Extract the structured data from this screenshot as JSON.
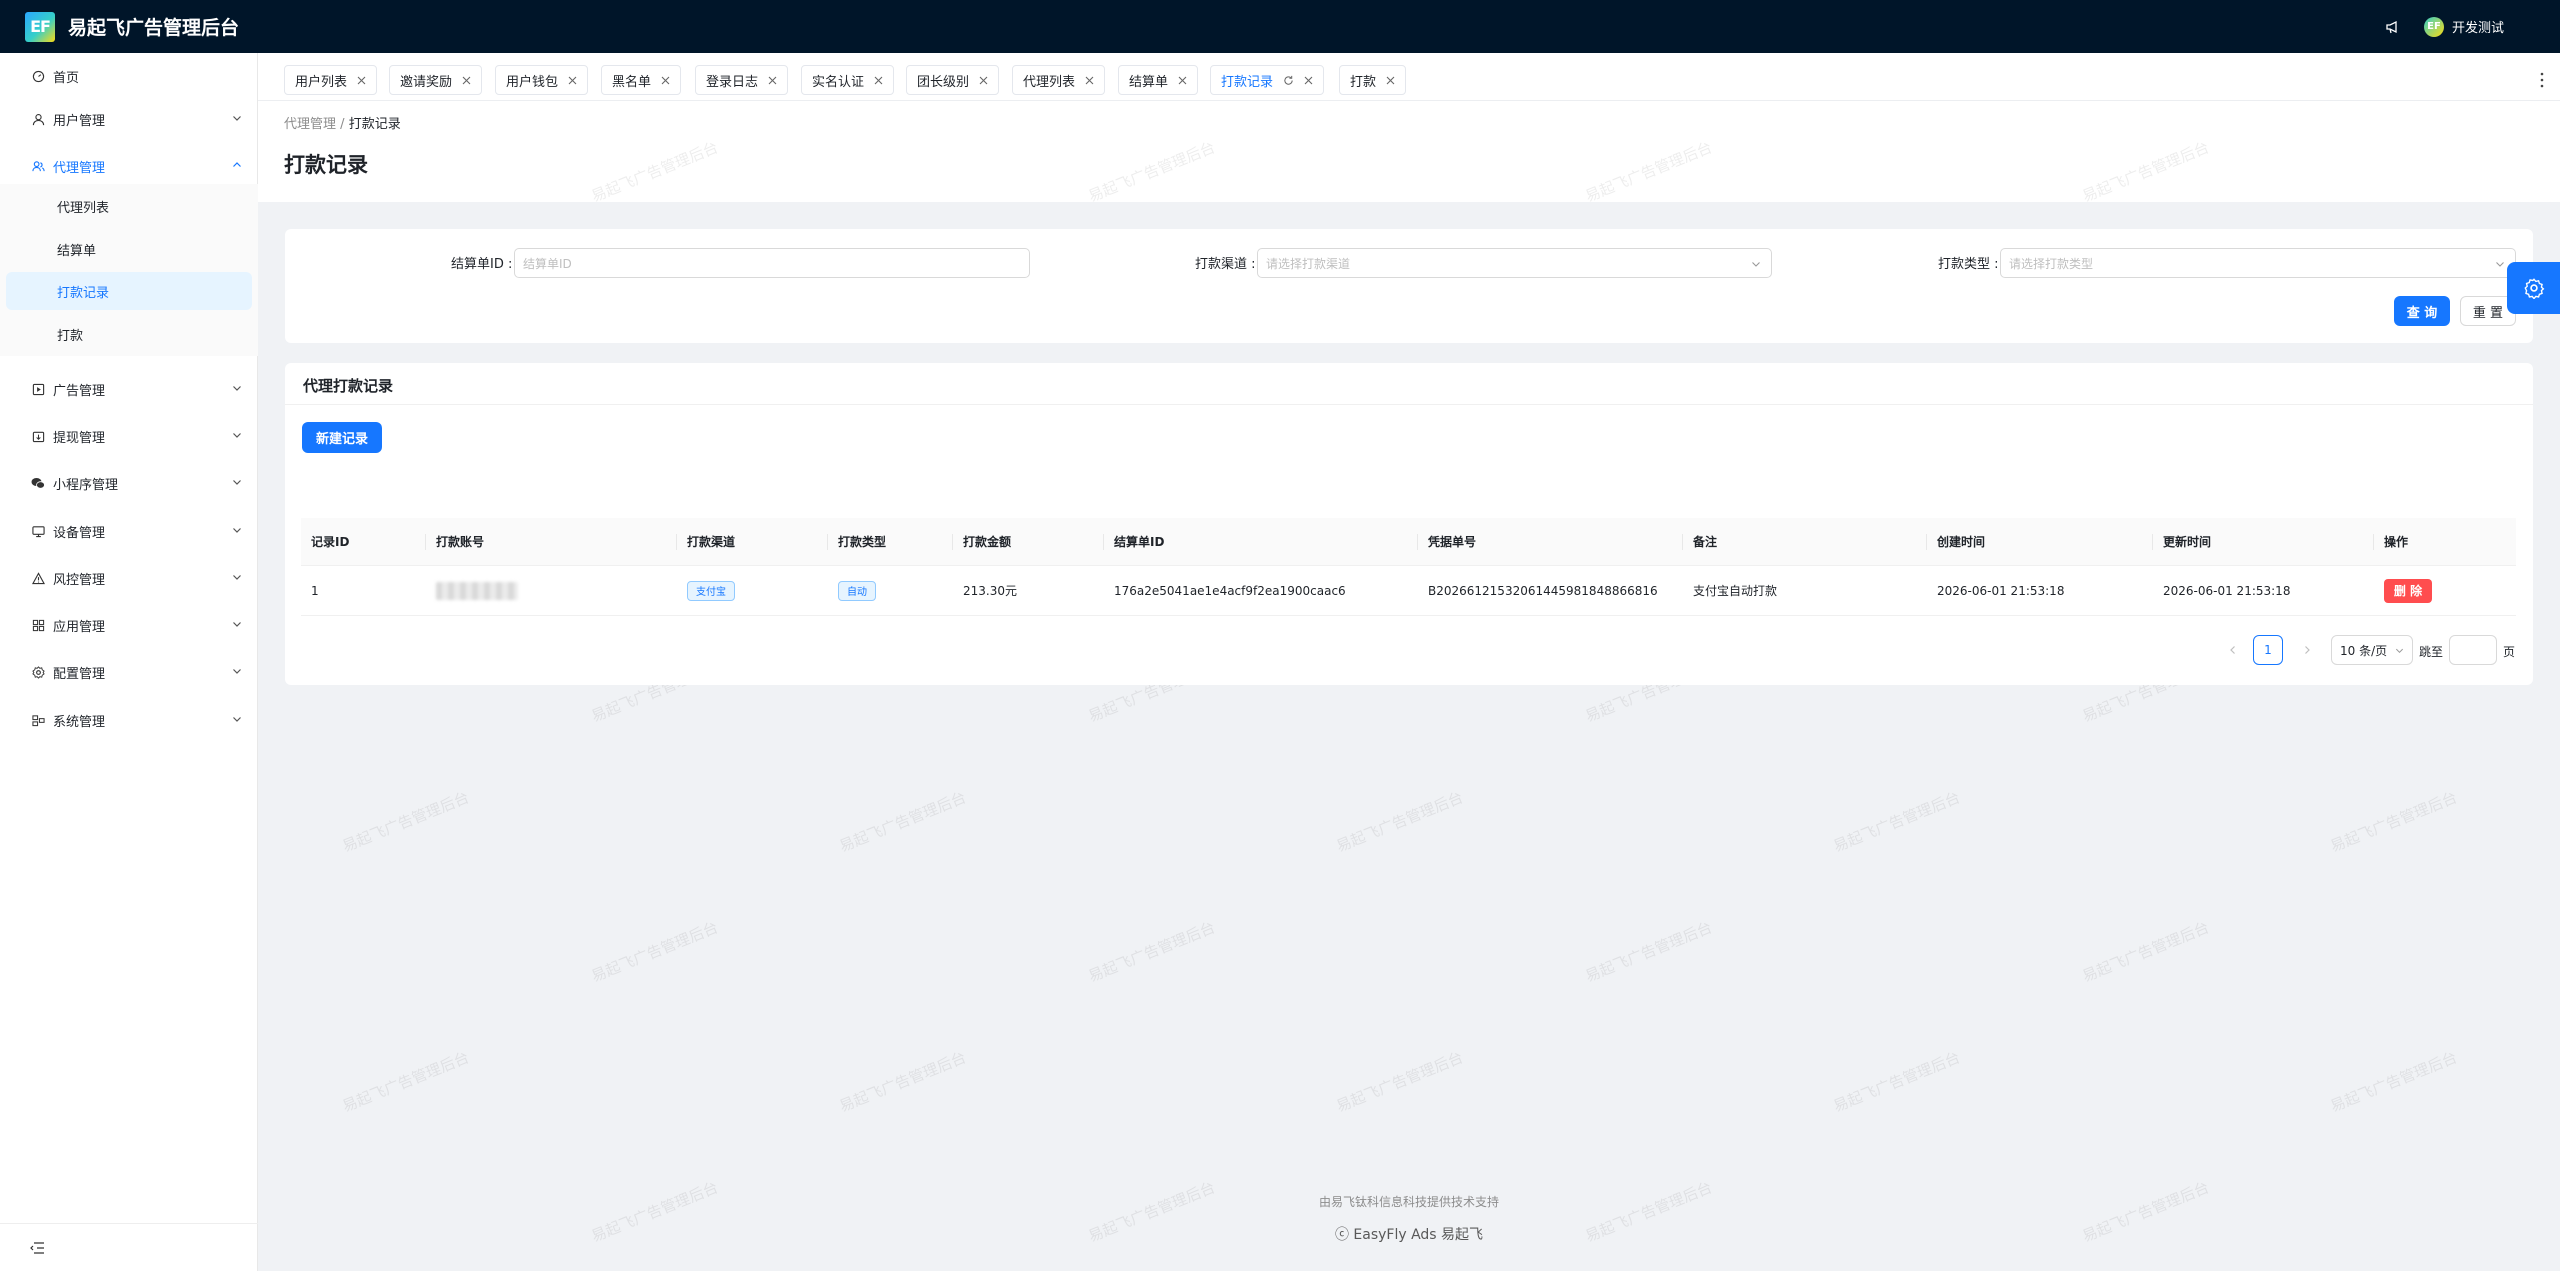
{
  "app": {
    "logo_text": "EF",
    "title": "易起飞广告管理后台"
  },
  "header": {
    "user_name": "开发测试",
    "avatar_text": "EF"
  },
  "sidebar": {
    "items": [
      {
        "label": "首页"
      },
      {
        "label": "用户管理"
      },
      {
        "label": "代理管理"
      },
      {
        "label": "广告管理"
      },
      {
        "label": "提现管理"
      },
      {
        "label": "小程序管理"
      },
      {
        "label": "设备管理"
      },
      {
        "label": "风控管理"
      },
      {
        "label": "应用管理"
      },
      {
        "label": "配置管理"
      },
      {
        "label": "系统管理"
      }
    ],
    "sub_items": [
      {
        "label": "代理列表"
      },
      {
        "label": "结算单"
      },
      {
        "label": "打款记录"
      },
      {
        "label": "打款"
      }
    ]
  },
  "tabs": [
    {
      "label": "用户列表"
    },
    {
      "label": "邀请奖励"
    },
    {
      "label": "用户钱包"
    },
    {
      "label": "黑名单"
    },
    {
      "label": "登录日志"
    },
    {
      "label": "实名认证"
    },
    {
      "label": "团长级别"
    },
    {
      "label": "代理列表"
    },
    {
      "label": "结算单"
    },
    {
      "label": "打款记录"
    },
    {
      "label": "打款"
    }
  ],
  "breadcrumb": {
    "parent": "代理管理",
    "separator": "/",
    "current": "打款记录"
  },
  "page_title": "打款记录",
  "search": {
    "settlement_id": {
      "label": "结算单ID :",
      "placeholder": "结算单ID"
    },
    "channel": {
      "label": "打款渠道 :",
      "placeholder": "请选择打款渠道"
    },
    "type": {
      "label": "打款类型 :",
      "placeholder": "请选择打款类型"
    },
    "query_label": "查 询",
    "reset_label": "重 置"
  },
  "table_card": {
    "title": "代理打款记录",
    "new_button": "新建记录",
    "columns": [
      "记录ID",
      "打款账号",
      "打款渠道",
      "打款类型",
      "打款金额",
      "结算单ID",
      "凭据单号",
      "备注",
      "创建时间",
      "更新时间",
      "操作"
    ],
    "rows": [
      {
        "id": "1",
        "channel": "支付宝",
        "type": "自动",
        "amount": "213.30元",
        "settlement_id": "176a2e5041ae1e4acf9f2ea1900caac6",
        "voucher_no": "B20266121532061445981848866816",
        "remark": "支付宝自动打款",
        "created_at": "2026-06-01 21:53:18",
        "updated_at": "2026-06-01 21:53:18",
        "action": "删 除"
      }
    ]
  },
  "pagination": {
    "current_page": "1",
    "page_size": "10 条/页",
    "jump_label": "跳至",
    "page_suffix": "页"
  },
  "footer": {
    "line1": "由易飞钛科信息科技提供技术支持",
    "line2": "ⓒ EasyFly Ads 易起飞"
  },
  "watermark": "易起飞广告管理后台",
  "colors": {
    "primary": "#1677ff",
    "danger": "#ff4d4f",
    "header_bg": "#001529"
  }
}
